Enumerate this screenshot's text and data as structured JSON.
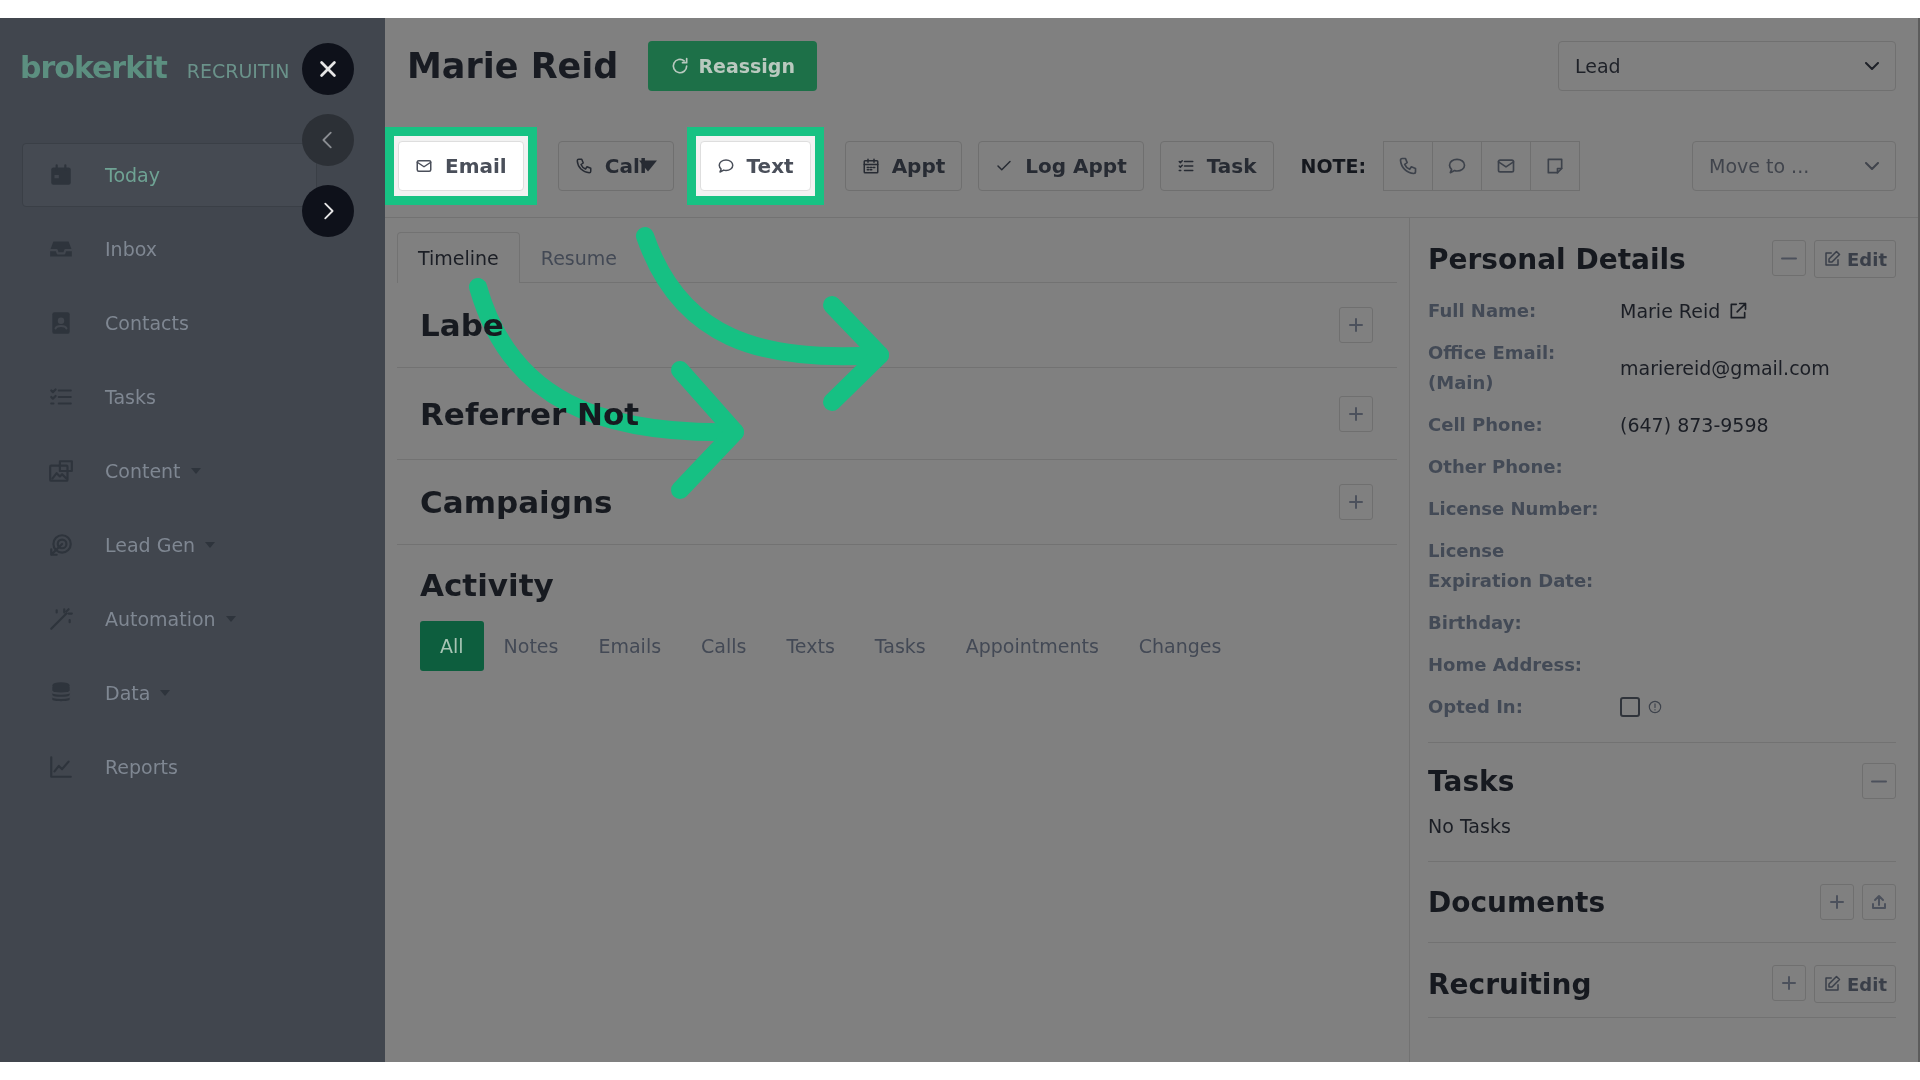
{
  "sidebar": {
    "logo": "brokerkit",
    "product": "RECRUITIN",
    "items": [
      {
        "label": "Today",
        "has_menu": false,
        "selected": true
      },
      {
        "label": "Inbox",
        "has_menu": false,
        "selected": false
      },
      {
        "label": "Contacts",
        "has_menu": false,
        "selected": false
      },
      {
        "label": "Tasks",
        "has_menu": false,
        "selected": false
      },
      {
        "label": "Content",
        "has_menu": true,
        "selected": false
      },
      {
        "label": "Lead Gen",
        "has_menu": true,
        "selected": false
      },
      {
        "label": "Automation",
        "has_menu": true,
        "selected": false
      },
      {
        "label": "Data",
        "has_menu": true,
        "selected": false
      },
      {
        "label": "Reports",
        "has_menu": false,
        "selected": false
      }
    ]
  },
  "panel_nav": [
    {
      "kind": "close",
      "disabled": false
    },
    {
      "kind": "prev",
      "disabled": true
    },
    {
      "kind": "next",
      "disabled": false
    }
  ],
  "header": {
    "name": "Marie Reid",
    "reassign": "Reassign",
    "stage": "Lead"
  },
  "actions": [
    {
      "kind": "email",
      "label": "Email",
      "dropdown": false,
      "highlighted": true
    },
    {
      "kind": "call",
      "label": "Call",
      "dropdown": true,
      "highlighted": false
    },
    {
      "kind": "text",
      "label": "Text",
      "dropdown": false,
      "highlighted": true
    },
    {
      "kind": "appt",
      "label": "Appt",
      "dropdown": false,
      "highlighted": false
    },
    {
      "kind": "log",
      "label": "Log Appt",
      "dropdown": false,
      "highlighted": false
    },
    {
      "kind": "task",
      "label": "Task",
      "dropdown": false,
      "highlighted": false
    }
  ],
  "note": {
    "label": "NOTE:",
    "buttons": [
      {
        "kind": "phone"
      },
      {
        "kind": "chat"
      },
      {
        "kind": "mail"
      },
      {
        "kind": "sticky"
      }
    ]
  },
  "move_to": {
    "placeholder": "Move to ..."
  },
  "tabs": [
    {
      "label": "Timeline",
      "selected": true
    },
    {
      "label": "Resume",
      "selected": false
    }
  ],
  "sections": [
    {
      "title": "Labe"
    },
    {
      "title": "Referrer Not"
    },
    {
      "title": "Campaigns"
    }
  ],
  "activity": {
    "title": "Activity",
    "filters": [
      {
        "label": "All",
        "selected": true
      },
      {
        "label": "Notes",
        "selected": false
      },
      {
        "label": "Emails",
        "selected": false
      },
      {
        "label": "Calls",
        "selected": false
      },
      {
        "label": "Texts",
        "selected": false
      },
      {
        "label": "Tasks",
        "selected": false
      },
      {
        "label": "Appointments",
        "selected": false
      },
      {
        "label": "Changes",
        "selected": false
      }
    ]
  },
  "personal_details": {
    "title": "Personal Details",
    "edit": "Edit",
    "fields": [
      {
        "label": "Full Name:",
        "kind": "link",
        "value": "Marie Reid"
      },
      {
        "label": "Office Email: (Main)",
        "kind": "text",
        "value": "mariereid@gmail.com"
      },
      {
        "label": "Cell Phone:",
        "kind": "text",
        "value": "(647) 873-9598"
      },
      {
        "label": "Other Phone:",
        "kind": "text"
      },
      {
        "label": "License Number:",
        "kind": "text"
      },
      {
        "label": "License Expiration Date:",
        "kind": "text"
      },
      {
        "label": "Birthday:",
        "kind": "text"
      },
      {
        "label": "Home Address:",
        "kind": "text"
      },
      {
        "label": "Opted In:",
        "kind": "checkbox",
        "checked": false
      }
    ]
  },
  "tasks": {
    "title": "Tasks",
    "empty": "No Tasks"
  },
  "documents": {
    "title": "Documents"
  },
  "recruiting": {
    "title": "Recruiting",
    "edit": "Edit"
  }
}
